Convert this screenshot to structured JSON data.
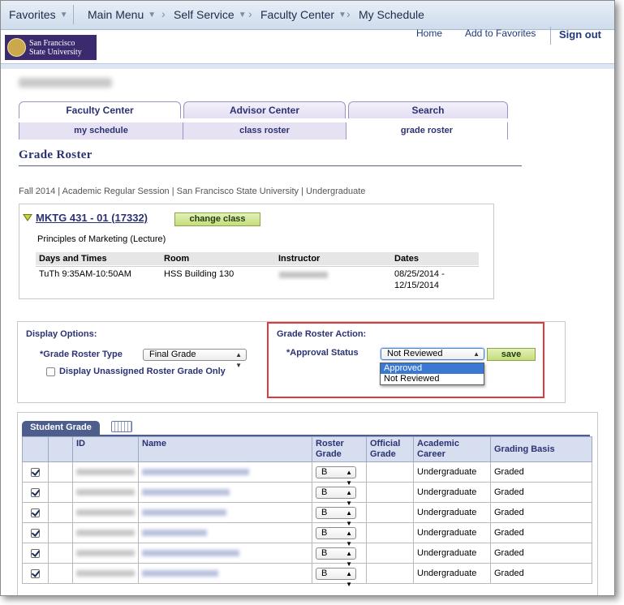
{
  "nav": {
    "favorites": "Favorites",
    "main_menu": "Main Menu",
    "self_service": "Self Service",
    "faculty_center": "Faculty Center",
    "my_schedule": "My Schedule"
  },
  "header": {
    "logo_line1": "San Francisco",
    "logo_line2": "State University",
    "home": "Home",
    "add_to_favorites": "Add to Favorites",
    "sign_out": "Sign out"
  },
  "tabs": [
    {
      "label": "Faculty Center"
    },
    {
      "label": "Advisor Center"
    },
    {
      "label": "Search"
    }
  ],
  "subtabs": [
    {
      "label": "my schedule"
    },
    {
      "label": "class roster"
    },
    {
      "label": "grade roster"
    }
  ],
  "page": {
    "title": "Grade Roster",
    "term": "Fall 2014 | Academic Regular Session | San Francisco State University | Undergraduate"
  },
  "class_info": {
    "title": "MKTG 431 - 01 (17332)",
    "change_class": "change class",
    "description": "Principles of Marketing (Lecture)",
    "headers": [
      "Days and Times",
      "Room",
      "Instructor",
      "Dates"
    ],
    "days_times": "TuTh 9:35AM-10:50AM",
    "room": "HSS Building 130",
    "dates_line1": "08/25/2014 -",
    "dates_line2": "12/15/2014"
  },
  "display_options": {
    "heading": "Display Options:",
    "roster_type_label": "*Grade Roster Type",
    "roster_type_value": "Final Grade",
    "unassigned_label": "Display Unassigned Roster Grade Only"
  },
  "action": {
    "heading": "Grade Roster Action:",
    "approval_label": "*Approval Status",
    "approval_value": "Not Reviewed",
    "options": [
      "Approved",
      "Not Reviewed"
    ],
    "save": "save"
  },
  "grid": {
    "tab_label": "Student Grade",
    "headers": {
      "id": "ID",
      "name": "Name",
      "roster_grade_1": "Roster",
      "roster_grade_2": "Grade",
      "official_grade_1": "Official",
      "official_grade_2": "Grade",
      "career_1": "Academic",
      "career_2": "Career",
      "basis": "Grading Basis"
    },
    "rows": [
      {
        "grade": "B",
        "career": "Undergraduate",
        "basis": "Graded"
      },
      {
        "grade": "B",
        "career": "Undergraduate",
        "basis": "Graded"
      },
      {
        "grade": "B",
        "career": "Undergraduate",
        "basis": "Graded"
      },
      {
        "grade": "B",
        "career": "Undergraduate",
        "basis": "Graded"
      },
      {
        "grade": "B",
        "career": "Undergraduate",
        "basis": "Graded"
      },
      {
        "grade": "B",
        "career": "Undergraduate",
        "basis": "Graded"
      }
    ]
  },
  "colors": {
    "brand_purple": "#3b2a6e",
    "link_blue": "#1f3a7a",
    "highlight_red": "#e0393e",
    "button_green": "#c6dd7c"
  }
}
